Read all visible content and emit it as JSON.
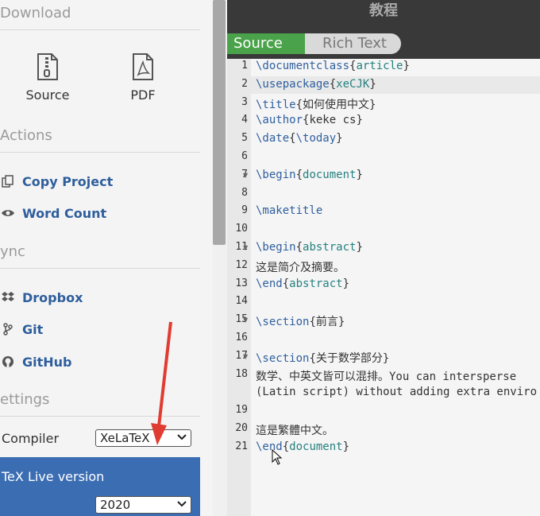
{
  "sidebar": {
    "download": {
      "title": "Download",
      "source_label": "Source",
      "pdf_label": "PDF"
    },
    "actions": {
      "title": "Actions",
      "copy_project": "Copy Project",
      "word_count": "Word Count"
    },
    "sync": {
      "title": "ync",
      "dropbox": "Dropbox",
      "git": "Git",
      "github": "GitHub"
    },
    "settings": {
      "title": "ettings",
      "compiler_label": "Compiler",
      "compiler_value": "XeLaTeX",
      "texlive_label": "TeX Live version",
      "texlive_value": "2020"
    }
  },
  "editor": {
    "title": "教程",
    "mode_source": "Source",
    "mode_rich": "Rich Text",
    "lines": [
      {
        "n": "1",
        "parts": [
          [
            "kw",
            "\\documentclass"
          ],
          [
            "p",
            "{"
          ],
          [
            "arg",
            "article"
          ],
          [
            "p",
            "}"
          ]
        ]
      },
      {
        "n": "2",
        "parts": [
          [
            "kw",
            "\\usepackage"
          ],
          [
            "p",
            "{"
          ],
          [
            "arg",
            "xeCJK"
          ],
          [
            "p",
            "}"
          ]
        ]
      },
      {
        "n": "3",
        "parts": [
          [
            "kw",
            "\\title"
          ],
          [
            "p",
            "{如何使用中文}"
          ]
        ]
      },
      {
        "n": "4",
        "parts": [
          [
            "kw",
            "\\author"
          ],
          [
            "p",
            "{keke cs}"
          ]
        ]
      },
      {
        "n": "5",
        "parts": [
          [
            "kw",
            "\\date"
          ],
          [
            "p",
            "{"
          ],
          [
            "kw",
            "\\today"
          ],
          [
            "p",
            "}"
          ]
        ]
      },
      {
        "n": "6",
        "parts": []
      },
      {
        "n": "7",
        "fold": true,
        "parts": [
          [
            "kw",
            "\\begin"
          ],
          [
            "p",
            "{"
          ],
          [
            "arg",
            "document"
          ],
          [
            "p",
            "}"
          ]
        ]
      },
      {
        "n": "8",
        "parts": []
      },
      {
        "n": "9",
        "parts": [
          [
            "kw",
            "\\maketitle"
          ]
        ]
      },
      {
        "n": "10",
        "parts": []
      },
      {
        "n": "11",
        "fold": true,
        "parts": [
          [
            "kw",
            "\\begin"
          ],
          [
            "p",
            "{"
          ],
          [
            "arg",
            "abstract"
          ],
          [
            "p",
            "}"
          ]
        ]
      },
      {
        "n": "12",
        "parts": [
          [
            "p",
            "这是简介及摘要。"
          ]
        ]
      },
      {
        "n": "13",
        "parts": [
          [
            "kw",
            "\\end"
          ],
          [
            "p",
            "{"
          ],
          [
            "arg",
            "abstract"
          ],
          [
            "p",
            "}"
          ]
        ]
      },
      {
        "n": "14",
        "parts": []
      },
      {
        "n": "15",
        "fold": true,
        "parts": [
          [
            "kw",
            "\\section"
          ],
          [
            "p",
            "{前言}"
          ]
        ]
      },
      {
        "n": "16",
        "parts": []
      },
      {
        "n": "17",
        "fold": true,
        "parts": [
          [
            "kw",
            "\\section"
          ],
          [
            "p",
            "{关于数学部分}"
          ]
        ]
      },
      {
        "n": "18",
        "parts": [
          [
            "p",
            "数学、中英文皆可以混排。You can intersperse"
          ]
        ]
      },
      {
        "n": "",
        "parts": [
          [
            "p",
            "(Latin script) without adding extra enviro"
          ]
        ]
      },
      {
        "n": "19",
        "parts": []
      },
      {
        "n": "20",
        "parts": [
          [
            "p",
            "這是繁體中文。"
          ]
        ]
      },
      {
        "n": "21",
        "parts": [
          [
            "kw",
            "\\end"
          ],
          [
            "p",
            "{"
          ],
          [
            "arg",
            "document"
          ],
          [
            "p",
            "}"
          ]
        ]
      }
    ]
  },
  "colors": {
    "accent_blue": "#3b6db3",
    "source_green": "#4aa34a",
    "link_blue": "#2e5e9c",
    "annotation_red": "#e03c31"
  }
}
